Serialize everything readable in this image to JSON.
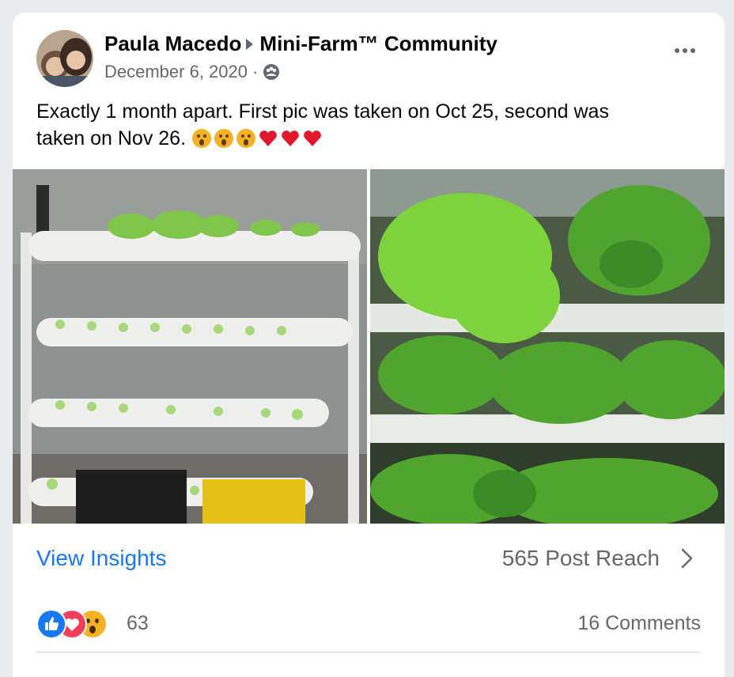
{
  "post": {
    "author": "Paula Macedo",
    "group": "Mini-Farm™ Community",
    "date": "December 6, 2020",
    "separator": "·",
    "privacy_icon": "group-icon",
    "more_icon": "more-horizontal-icon",
    "text_line1": "Exactly 1 month apart. First pic was taken on Oct 25, second was",
    "text_line2": "taken on Nov 26.",
    "emoji": [
      "astonished-face",
      "astonished-face",
      "astonished-face",
      "red-heart",
      "red-heart",
      "red-heart"
    ]
  },
  "insights": {
    "view_label": "View Insights",
    "reach_label": "565 Post Reach",
    "chevron_icon": "chevron-right-icon"
  },
  "reactions": {
    "types": [
      "like",
      "love",
      "wow"
    ],
    "count": "63",
    "comments_label": "16 Comments"
  },
  "colors": {
    "link": "#1877f2",
    "secondary_text": "#65676b",
    "like": "#1877f2",
    "love": "#f33e58",
    "wow": "#f7b125"
  }
}
